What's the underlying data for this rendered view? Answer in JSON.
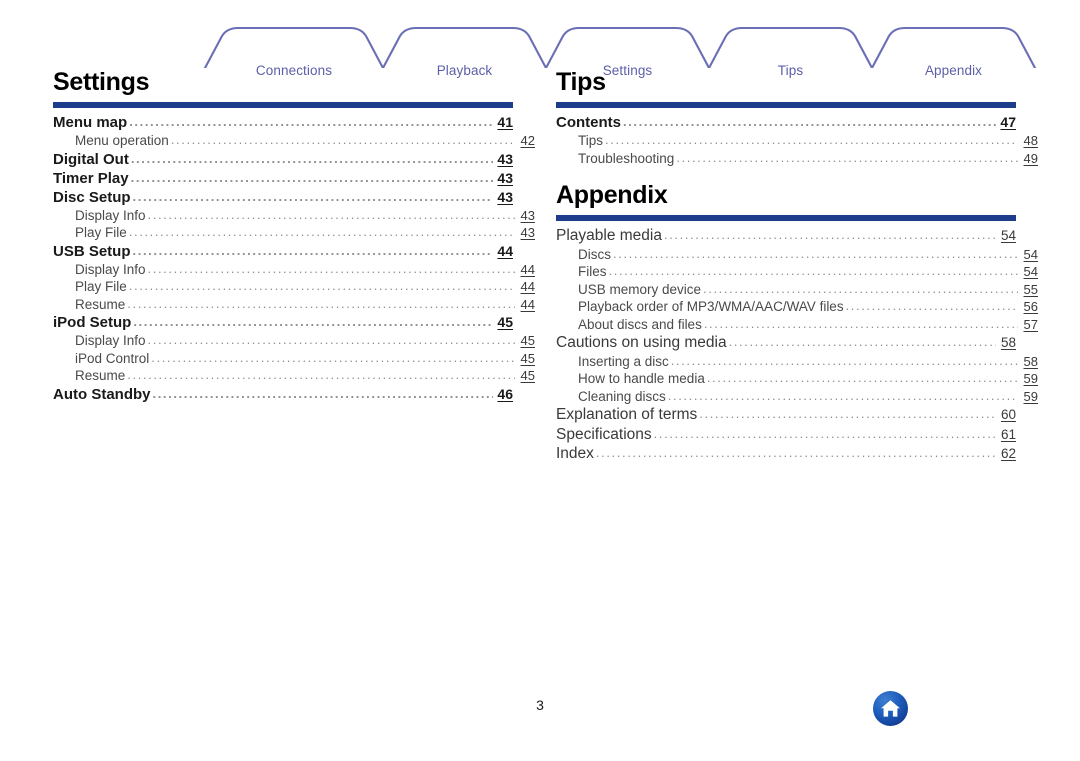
{
  "tabs": [
    {
      "label": "Connections"
    },
    {
      "label": "Playback"
    },
    {
      "label": "Settings"
    },
    {
      "label": "Tips"
    },
    {
      "label": "Appendix"
    }
  ],
  "colors": {
    "rule_navy": "#1e3c8c",
    "tab_outline": "#6a6fb5",
    "tab_text": "#5b5fa8",
    "leader_gray": "#8d8d8d",
    "home_blue": "#1f5fbe"
  },
  "left_column": {
    "sections": [
      {
        "title": "Settings",
        "entries": [
          {
            "label": "Menu map",
            "page": "41",
            "level": 1
          },
          {
            "label": "Menu operation",
            "page": "42",
            "level": 2
          },
          {
            "label": "Digital Out",
            "page": "43",
            "level": 1
          },
          {
            "label": "Timer Play",
            "page": "43",
            "level": 1
          },
          {
            "label": "Disc Setup",
            "page": "43",
            "level": 1
          },
          {
            "label": "Display Info",
            "page": "43",
            "level": 2
          },
          {
            "label": "Play File",
            "page": "43",
            "level": 2
          },
          {
            "label": "USB Setup",
            "page": "44",
            "level": 1
          },
          {
            "label": "Display Info",
            "page": "44",
            "level": 2
          },
          {
            "label": "Play File",
            "page": "44",
            "level": 2
          },
          {
            "label": "Resume",
            "page": "44",
            "level": 2
          },
          {
            "label": "iPod Setup",
            "page": "45",
            "level": 1
          },
          {
            "label": "Display Info",
            "page": "45",
            "level": 2
          },
          {
            "label": "iPod Control",
            "page": "45",
            "level": 2
          },
          {
            "label": "Resume",
            "page": "45",
            "level": 2
          },
          {
            "label": "Auto Standby",
            "page": "46",
            "level": 1
          }
        ]
      }
    ]
  },
  "right_column": {
    "sections": [
      {
        "title": "Tips",
        "entries": [
          {
            "label": "Contents",
            "page": "47",
            "level": 1
          },
          {
            "label": "Tips",
            "page": "48",
            "level": 2
          },
          {
            "label": "Troubleshooting",
            "page": "49",
            "level": 2
          }
        ]
      },
      {
        "title": "Appendix",
        "entries": [
          {
            "label": "Playable media",
            "page": "54",
            "level": "1r"
          },
          {
            "label": "Discs",
            "page": "54",
            "level": 2
          },
          {
            "label": "Files",
            "page": "54",
            "level": 2
          },
          {
            "label": "USB memory device",
            "page": "55",
            "level": 2
          },
          {
            "label": "Playback order of MP3/WMA/AAC/WAV files",
            "page": "56",
            "level": 2
          },
          {
            "label": "About discs and files",
            "page": "57",
            "level": 2
          },
          {
            "label": "Cautions on using media",
            "page": "58",
            "level": "1r"
          },
          {
            "label": "Inserting a disc",
            "page": "58",
            "level": 2
          },
          {
            "label": "How to handle media",
            "page": "59",
            "level": 2
          },
          {
            "label": "Cleaning discs",
            "page": "59",
            "level": 2
          },
          {
            "label": "Explanation of terms",
            "page": "60",
            "level": "1r"
          },
          {
            "label": "Specifications",
            "page": "61",
            "level": "1r"
          },
          {
            "label": "Index",
            "page": "62",
            "level": "1r"
          }
        ]
      }
    ]
  },
  "footer": {
    "page_number": "3",
    "home_icon": "home-icon"
  }
}
